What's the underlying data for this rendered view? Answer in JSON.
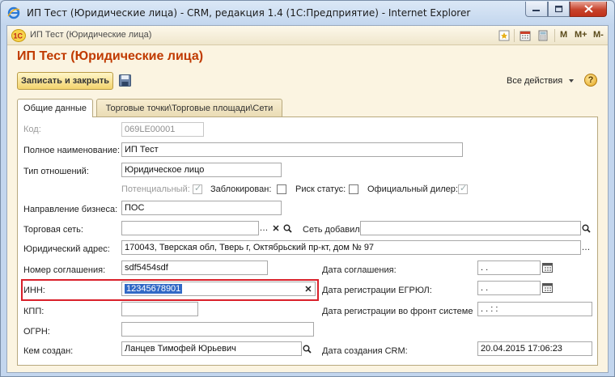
{
  "window": {
    "title": "ИП Тест (Юридические лица) - CRM, редакция 1.4 (1С:Предприятие) - Internet Explorer"
  },
  "toolbar": {
    "title": "ИП Тест (Юридические лица)",
    "m": "M",
    "m_plus": "M+",
    "m_minus": "M-"
  },
  "form": {
    "title": "ИП Тест (Юридические лица)",
    "save_close": "Записать и закрыть",
    "all_actions": "Все действия",
    "help": "?"
  },
  "tabs": [
    {
      "label": "Общие данные"
    },
    {
      "label": "Торговые точки\\Торговые площади\\Сети"
    }
  ],
  "fields": {
    "code_label": "Код:",
    "code_value": "069LE00001",
    "fullname_label": "Полное наименование:",
    "fullname_value": "ИП Тест",
    "relation_label": "Тип отношений:",
    "relation_value": "Юридическое лицо",
    "potential_label": "Потенциальный:",
    "blocked_label": "Заблокирован:",
    "risk_label": "Риск статус:",
    "dealer_label": "Официальный дилер:",
    "business_label": "Направление бизнеса:",
    "business_value": "ПОС",
    "network_label": "Торговая сеть:",
    "network_value": "",
    "network_added_label": "Сеть добавил",
    "network_added_value": "",
    "address_label": "Юридический адрес:",
    "address_value": "170043, Тверская обл, Тверь г, Октябрьский пр-кт, дом № 97",
    "agreement_label": "Номер соглашения:",
    "agreement_value": "sdf5454sdf",
    "agreement_date_label": "Дата соглашения:",
    "agreement_date_value": " .  .",
    "inn_label": "ИНН:",
    "inn_value": "12345678901",
    "egrul_date_label": "Дата регистрации ЕГРЮЛ:",
    "egrul_date_value": " .  .",
    "kpp_label": "КПП:",
    "kpp_value": "",
    "front_date_label": "Дата регистрации во фронт системе",
    "front_date_value": " .  .       :  :",
    "ogrn_label": "ОГРН:",
    "ogrn_value": "",
    "created_by_label": "Кем создан:",
    "created_by_value": "Ланцев Тимофей Юрьевич",
    "created_date_label": "Дата создания CRM:",
    "created_date_value": "20.04.2015 17:06:23"
  },
  "icons": {
    "browser": "ie-icon",
    "app": "1c-logo-icon",
    "save": "floppy-icon",
    "select": "ellipsis-icon",
    "clear": "clear-x-icon",
    "search": "magnifier-icon",
    "calendar": "calendar-icon"
  },
  "colors": {
    "title_orange": "#c03a00",
    "highlight_red": "#d9202a",
    "selection_blue": "#3169c6",
    "button_yellow": "#f3d36d"
  }
}
